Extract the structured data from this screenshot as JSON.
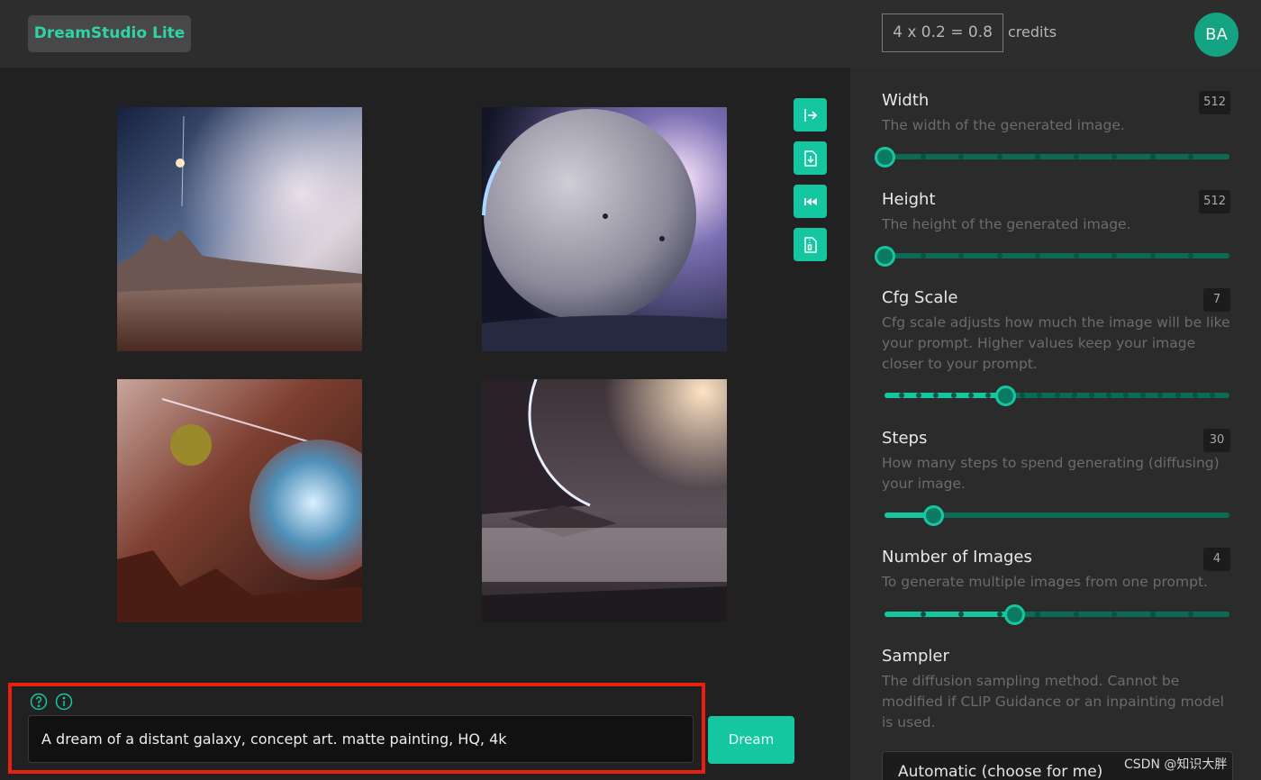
{
  "header": {
    "brand": "DreamStudio Lite",
    "credits_formula": "4 x 0.2 = 0.8",
    "credits_label": "credits",
    "avatar_initials": "BA"
  },
  "prompt": {
    "value": "A dream of a distant galaxy, concept art. matte painting, HQ, 4k",
    "dream_label": "Dream"
  },
  "settings": {
    "width": {
      "title": "Width",
      "value": "512",
      "description": "The width of the generated image.",
      "level": 0.0
    },
    "height": {
      "title": "Height",
      "value": "512",
      "description": "The height of the generated image.",
      "level": 0.0
    },
    "cfg_scale": {
      "title": "Cfg Scale",
      "value": "7",
      "description": "Cfg scale adjusts how much the image will be like your prompt. Higher values keep your image closer to your prompt.",
      "level": 0.35
    },
    "steps": {
      "title": "Steps",
      "value": "30",
      "description": "How many steps to spend generating (diffusing) your image.",
      "level": 0.14
    },
    "num_images": {
      "title": "Number of Images",
      "value": "4",
      "description": "To generate multiple images from one prompt.",
      "level": 0.375
    },
    "sampler": {
      "title": "Sampler",
      "description": "The diffusion sampling method. Cannot be modified if CLIP Guidance or an inpainting model is used.",
      "selected": "Automatic (choose for me)"
    }
  },
  "watermark": "CSDN @知识大胖",
  "colors": {
    "accent": "#14c7a1",
    "brand_text": "#2fd3a4",
    "highlight_border": "#e8210f"
  },
  "icons": [
    "export-icon",
    "download-file-icon",
    "rewind-icon",
    "zip-file-icon",
    "help-question-icon",
    "info-icon"
  ]
}
